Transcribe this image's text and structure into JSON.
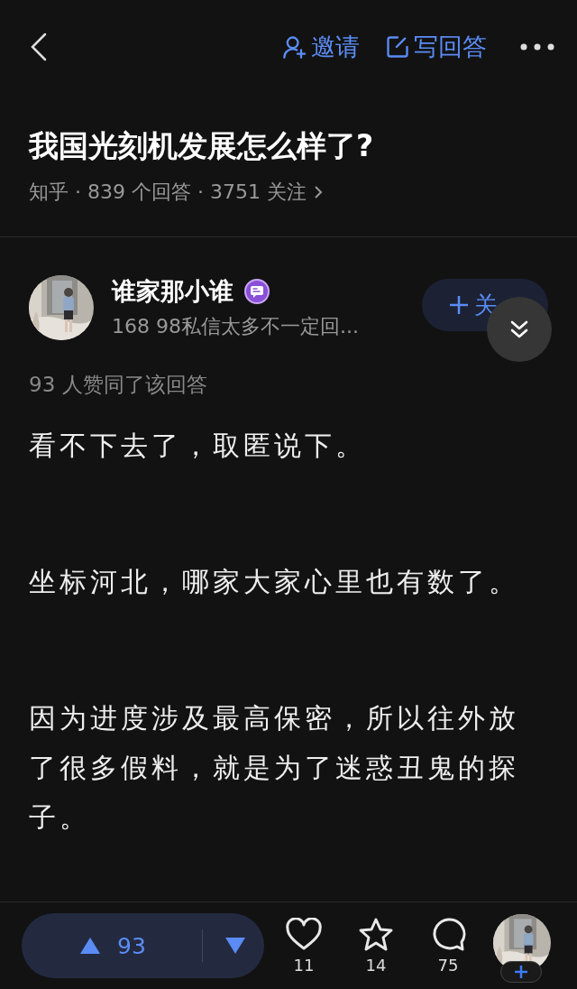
{
  "top_bar": {
    "actions": [
      {
        "kind": "invite",
        "label": "邀请"
      },
      {
        "kind": "write",
        "label": "写回答"
      }
    ]
  },
  "question": {
    "title": "我国光刻机发展怎么样了?",
    "meta": "知乎 · 839 个回答 · 3751 关注"
  },
  "author": {
    "name": "谁家那小谁",
    "bio": "168 98私信太多不一定回...",
    "follow_label": "关"
  },
  "upvote_summary": "93 人赞同了该回答",
  "paragraphs": [
    "看不下去了，取匿说下。",
    "坐标河北，哪家大家心里也有数了。",
    "因为进度涉及最高保密，所以往外放了很多假料，就是为了迷惑丑鬼的探子。"
  ],
  "bottom_bar": {
    "votes": "93",
    "actions": [
      {
        "kind": "heart",
        "count": "11"
      },
      {
        "kind": "star",
        "count": "14"
      },
      {
        "kind": "comment",
        "count": "75"
      }
    ]
  }
}
